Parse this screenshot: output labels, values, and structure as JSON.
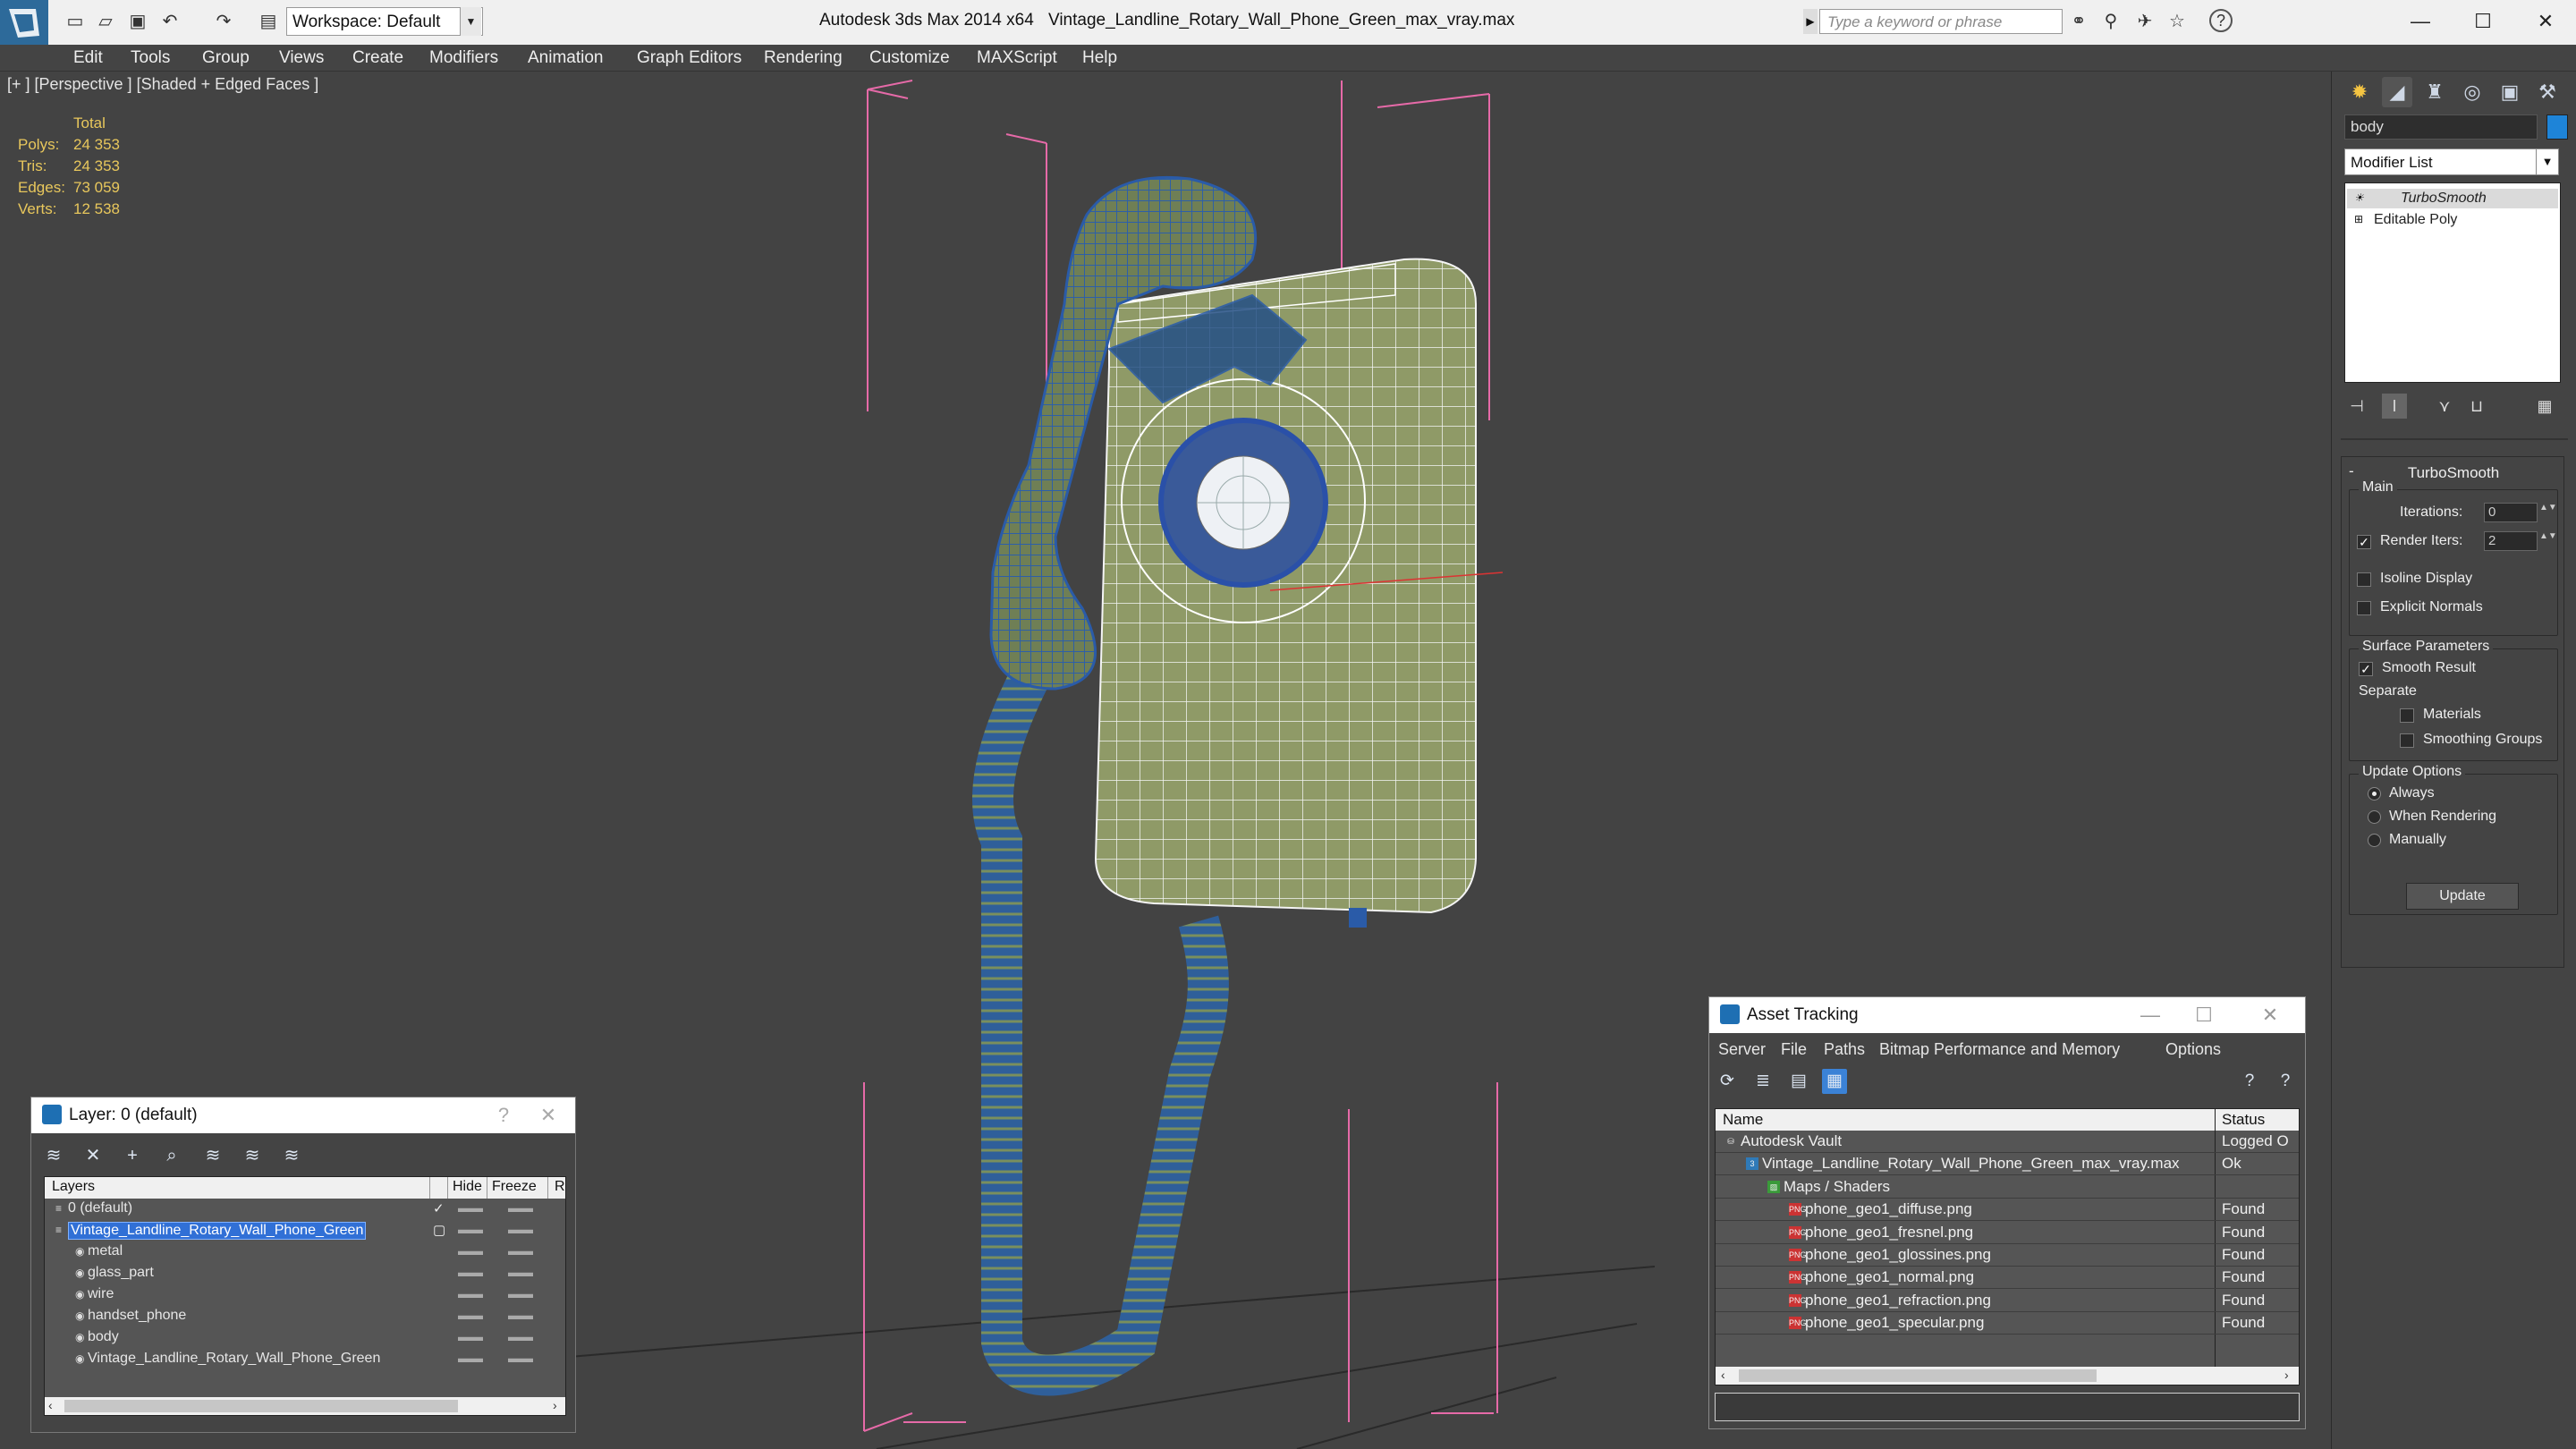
{
  "title_bar": {
    "app_title": "Autodesk 3ds Max  2014 x64",
    "file_title": "Vintage_Landline_Rotary_Wall_Phone_Green_max_vray.max",
    "workspace_label": "Workspace: Default",
    "search_placeholder": "Type a keyword or phrase"
  },
  "menu": [
    "Edit",
    "Tools",
    "Group",
    "Views",
    "Create",
    "Modifiers",
    "Animation",
    "Graph Editors",
    "Rendering",
    "Customize",
    "MAXScript",
    "Help"
  ],
  "viewport": {
    "label": "[+ ] [Perspective ] [Shaded + Edged Faces ]",
    "stats_header": "Total",
    "stats": [
      {
        "key": "Polys:",
        "value": "24 353"
      },
      {
        "key": "Tris:",
        "value": "24 353"
      },
      {
        "key": "Edges:",
        "value": "73 059"
      },
      {
        "key": "Verts:",
        "value": "12 538"
      }
    ]
  },
  "command_panel": {
    "object_name": "body",
    "object_color": "#1e84d8",
    "modifier_list_label": "Modifier List",
    "stack": [
      "TurboSmooth",
      "Editable Poly"
    ],
    "rollout": {
      "title": "TurboSmooth",
      "main_group": "Main",
      "iterations_label": "Iterations:",
      "iterations_value": "0",
      "render_iters_label": "Render Iters:",
      "render_iters_value": "2",
      "isoline_label": "Isoline Display",
      "explicit_normals_label": "Explicit Normals",
      "surface_group": "Surface Parameters",
      "smooth_result_label": "Smooth Result",
      "separate_label": "Separate",
      "materials_label": "Materials",
      "smoothing_groups_label": "Smoothing Groups",
      "update_group": "Update Options",
      "always_label": "Always",
      "when_rendering_label": "When Rendering",
      "manually_label": "Manually",
      "update_button": "Update"
    }
  },
  "layer_dialog": {
    "title": "Layer: 0 (default)",
    "columns": [
      "Layers",
      "Hide",
      "Freeze",
      "R"
    ],
    "rows": [
      {
        "name": "0 (default)",
        "level": 0,
        "selected": false,
        "checked": true
      },
      {
        "name": "Vintage_Landline_Rotary_Wall_Phone_Green",
        "level": 0,
        "selected": true,
        "checked": false
      },
      {
        "name": "metal",
        "level": 1,
        "selected": false,
        "checked": false
      },
      {
        "name": "glass_part",
        "level": 1,
        "selected": false,
        "checked": false
      },
      {
        "name": "wire",
        "level": 1,
        "selected": false,
        "checked": false
      },
      {
        "name": "handset_phone",
        "level": 1,
        "selected": false,
        "checked": false
      },
      {
        "name": "body",
        "level": 1,
        "selected": false,
        "checked": false
      },
      {
        "name": "Vintage_Landline_Rotary_Wall_Phone_Green",
        "level": 1,
        "selected": false,
        "checked": false
      }
    ]
  },
  "asset_tracking": {
    "title": "Asset Tracking",
    "menu": [
      "Server",
      "File",
      "Paths",
      "Bitmap Performance and Memory",
      "Options"
    ],
    "columns": [
      "Name",
      "Status"
    ],
    "rows": [
      {
        "name": "Autodesk Vault",
        "status": "Logged O",
        "level": 0,
        "icon": "vault"
      },
      {
        "name": "Vintage_Landline_Rotary_Wall_Phone_Green_max_vray.max",
        "status": "Ok",
        "level": 1,
        "icon": "max"
      },
      {
        "name": "Maps / Shaders",
        "status": "",
        "level": 2,
        "icon": "maps"
      },
      {
        "name": "phone_geo1_diffuse.png",
        "status": "Found",
        "level": 3,
        "icon": "png"
      },
      {
        "name": "phone_geo1_fresnel.png",
        "status": "Found",
        "level": 3,
        "icon": "png"
      },
      {
        "name": "phone_geo1_glossines.png",
        "status": "Found",
        "level": 3,
        "icon": "png"
      },
      {
        "name": "phone_geo1_normal.png",
        "status": "Found",
        "level": 3,
        "icon": "png"
      },
      {
        "name": "phone_geo1_refraction.png",
        "status": "Found",
        "level": 3,
        "icon": "png"
      },
      {
        "name": "phone_geo1_specular.png",
        "status": "Found",
        "level": 3,
        "icon": "png"
      }
    ]
  }
}
